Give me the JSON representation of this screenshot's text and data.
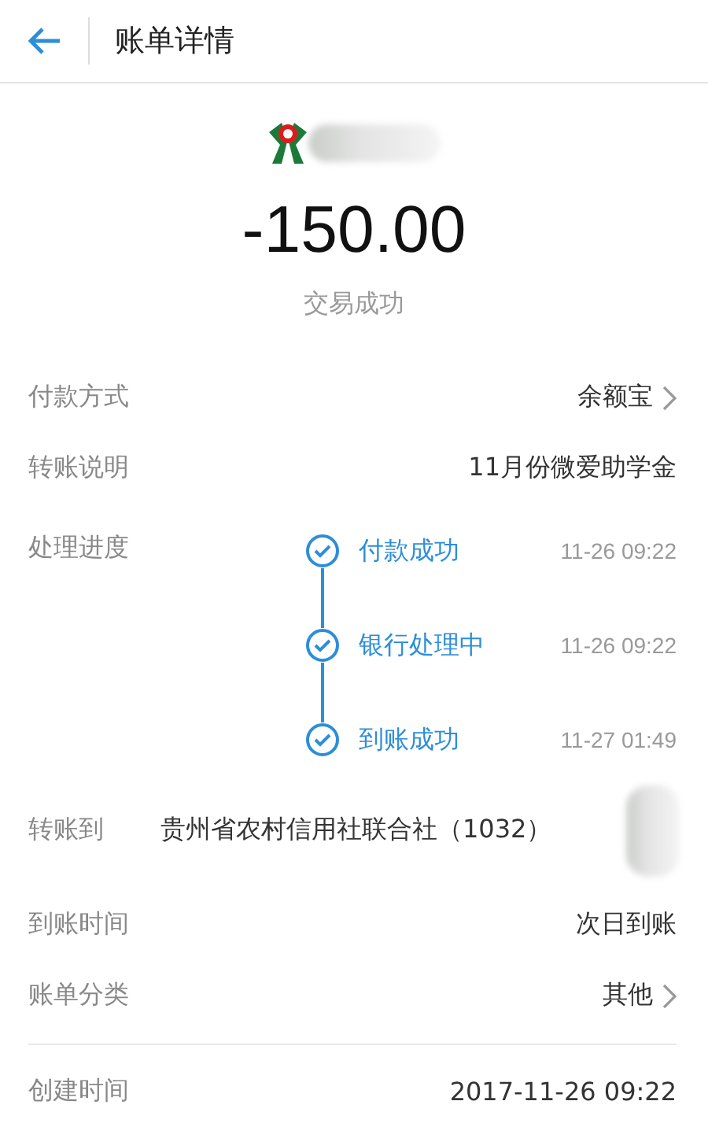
{
  "header": {
    "title": "账单详情"
  },
  "summary": {
    "amount": "-150.00",
    "status": "交易成功"
  },
  "rows_top": [
    {
      "label": "付款方式",
      "value": "余额宝",
      "arrow": true
    },
    {
      "label": "转账说明",
      "value": "11月份微爱助学金",
      "arrow": false
    }
  ],
  "progress": {
    "label": "处理进度",
    "steps": [
      {
        "text": "付款成功",
        "time": "11-26 09:22",
        "done": true
      },
      {
        "text": "银行处理中",
        "time": "11-26 09:22",
        "done": true
      },
      {
        "text": "到账成功",
        "time": "11-27 01:49",
        "done": true
      }
    ]
  },
  "transfer_to": {
    "label": "转账到",
    "value": "贵州省农村信用社联合社（1032）"
  },
  "rows_bottom": [
    {
      "label": "到账时间",
      "value": "次日到账",
      "arrow": false
    },
    {
      "label": "账单分类",
      "value": "其他",
      "arrow": true
    }
  ],
  "created": {
    "label": "创建时间",
    "value": "2017-11-26 09:22"
  }
}
